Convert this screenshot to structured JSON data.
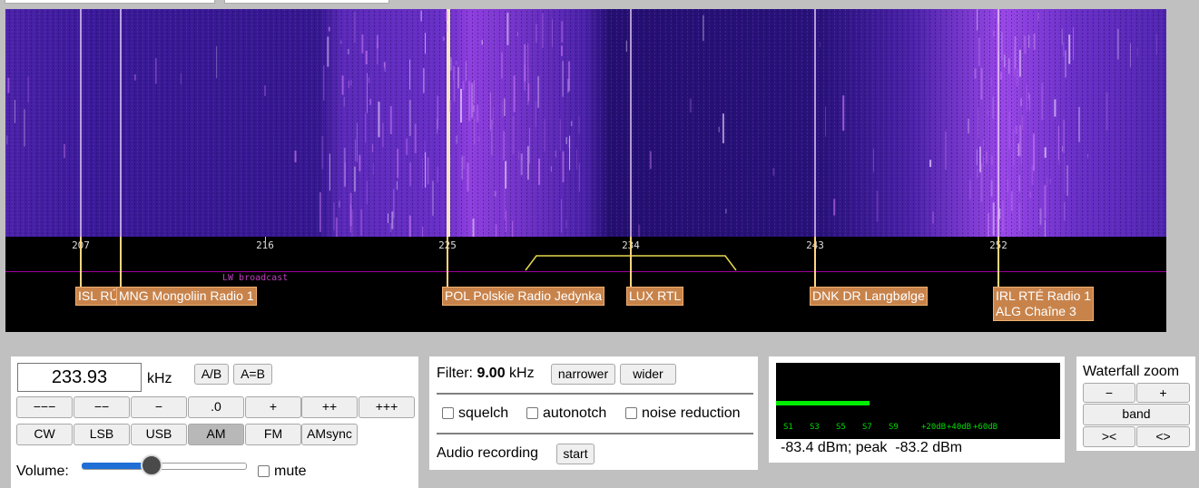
{
  "scale": {
    "ticks": [
      "207",
      "216",
      "225",
      "234",
      "243",
      "252"
    ],
    "band_label": "LW broadcast",
    "stations": [
      {
        "name": "ISL RÚV"
      },
      {
        "name": "MNG Mongoliin Radio 1"
      },
      {
        "name": "POL Polskie Radio Jedynka"
      },
      {
        "name": "LUX RTL"
      },
      {
        "name": "DNK DR Langbølge"
      },
      {
        "name": "IRL RTÉ Radio 1\nALG Chaîne 3"
      }
    ]
  },
  "frequency": {
    "value": "233.93",
    "unit": "kHz",
    "ab_label": "A/B",
    "aeqb_label": "A=B",
    "steps": [
      "−−−",
      "−−",
      "−",
      ".0",
      "+",
      "++",
      "+++"
    ],
    "modes": [
      "CW",
      "LSB",
      "USB",
      "AM",
      "FM",
      "AMsync"
    ],
    "active_mode": "AM",
    "volume_label": "Volume:",
    "volume_level": 0.43,
    "mute_label": "mute"
  },
  "filter": {
    "label": "Filter:",
    "value": "9.00",
    "unit": "kHz",
    "narrower": "narrower",
    "wider": "wider",
    "squelch": "squelch",
    "autonotch": "autonotch",
    "noise_reduction": "noise reduction",
    "audio_recording": "Audio recording",
    "start": "start"
  },
  "smeter": {
    "labels": [
      "S1",
      "S3",
      "S5",
      "S7",
      "S9",
      "+20dB",
      "+40dB",
      "+60dB"
    ],
    "level_fraction": 0.33,
    "reading": "-83.4 dBm; peak  -83.2 dBm"
  },
  "zoom": {
    "title": "Waterfall zoom",
    "minus": "−",
    "plus": "+",
    "band": "band",
    "left": "><",
    "right": "<>"
  },
  "colors": {
    "waterfall_base": "#2a1278",
    "station_bg": "#c8834b",
    "passband": "#e6d84a",
    "smeter_bar": "#00ee00"
  }
}
